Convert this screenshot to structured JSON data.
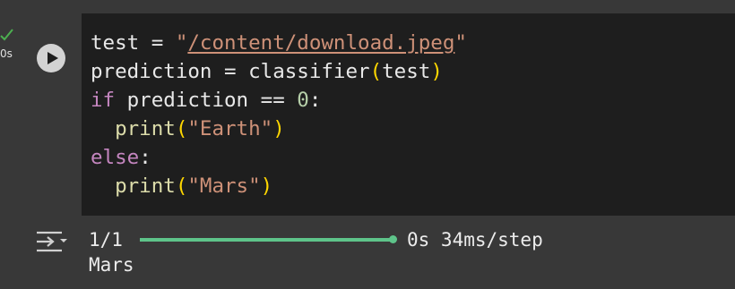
{
  "gutter": {
    "execution_time": "0s",
    "status_icon": "checkmark-icon",
    "status_color": "#4caf50"
  },
  "cell": {
    "run_button_icon": "play-icon",
    "code_lines": [
      "test = \"/content/download.jpeg\"",
      "prediction = classifier(test)",
      "if prediction == 0:",
      "  print(\"Earth\")",
      "else:",
      "  print(\"Mars\")"
    ],
    "tokens": {
      "l1_var": "test",
      "l1_op": " = ",
      "l1_q1": "\"",
      "l1_path": "/content/download.jpeg",
      "l1_q2": "\"",
      "l2_var": "prediction",
      "l2_op": " = ",
      "l2_fn": "classifier",
      "l2_p1": "(",
      "l2_arg": "test",
      "l2_p2": ")",
      "l3_kw": "if",
      "l3_cond": " prediction == ",
      "l3_num": "0",
      "l3_colon": ":",
      "l4_indent": "  ",
      "l4_fn": "print",
      "l4_p1": "(",
      "l4_str": "\"Earth\"",
      "l4_p2": ")",
      "l5_kw": "else",
      "l5_colon": ":",
      "l6_indent": "  ",
      "l6_fn": "print",
      "l6_p1": "(",
      "l6_str": "\"Mars\"",
      "l6_p2": ")"
    }
  },
  "output": {
    "icon": "output-toggle-icon",
    "progress": {
      "step_count": "1/1",
      "fraction": 1.0,
      "timing": "0s 34ms/step",
      "color": "#5ec48a"
    },
    "printed": "Mars"
  },
  "colors": {
    "editor_bg": "#1e1e1e",
    "chrome_bg": "#383838",
    "string": "#ce9178",
    "keyword": "#c586c0",
    "number": "#b5cea8",
    "bracket": "#ffd700"
  }
}
